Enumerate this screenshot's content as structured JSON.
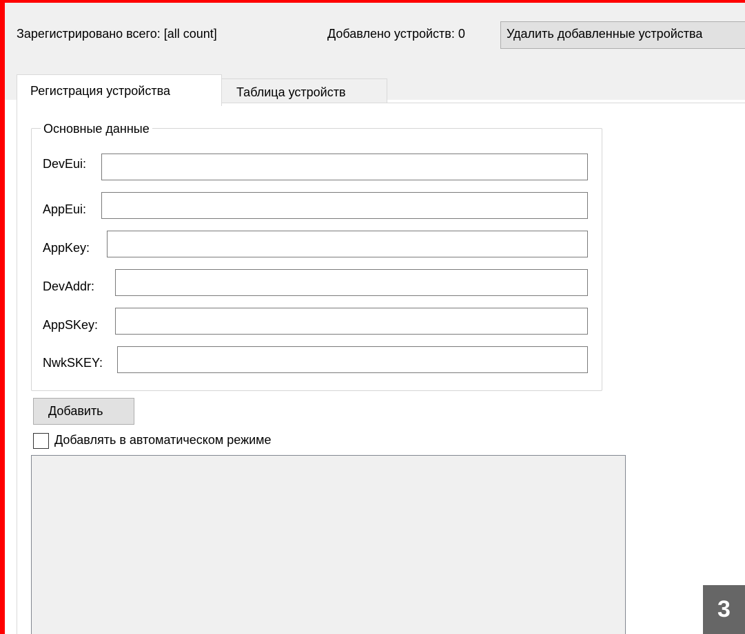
{
  "header": {
    "total_registered": "Зарегистрировано всего: [all count]",
    "added_devices": "Добавлено устройств: 0",
    "delete_button": "Удалить добавленные устройства"
  },
  "tabs": [
    {
      "label": "Регистрация устройства",
      "selected": true
    },
    {
      "label": "Таблица устройств",
      "selected": false
    }
  ],
  "group": {
    "title": "Основные данные",
    "fields": [
      {
        "label": "DevEui:",
        "value": ""
      },
      {
        "label": "AppEui:",
        "value": ""
      },
      {
        "label": "AppKey:",
        "value": ""
      },
      {
        "label": "DevAddr:",
        "value": ""
      },
      {
        "label": "AppSKey:",
        "value": ""
      },
      {
        "label": "NwkSKEY:",
        "value": ""
      }
    ]
  },
  "add_button": {
    "mnemonic": "Д",
    "rest": "обавить"
  },
  "auto_mode": {
    "label": "Добавлять в автоматическом режиме",
    "checked": false
  },
  "badge": "3",
  "colors": {
    "frame": "#ff0000",
    "window_bg": "#f0f0f0",
    "badge_bg": "#666666"
  }
}
